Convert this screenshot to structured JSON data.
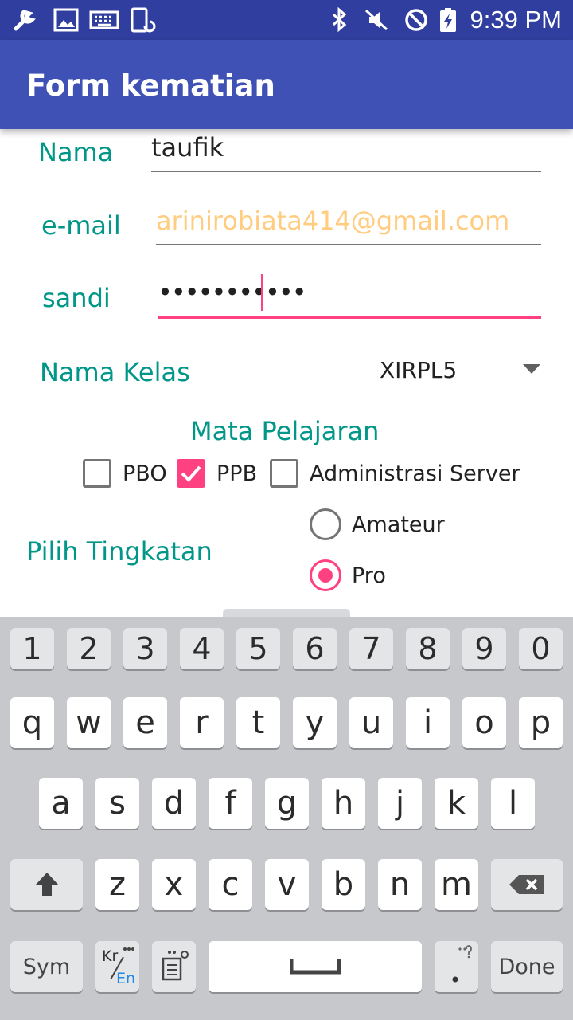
{
  "status_bar": {
    "time": "9:39 PM",
    "icons": [
      "wrench-icon",
      "image-icon",
      "keyboard-icon",
      "phone-sync-icon",
      "bluetooth-icon",
      "mute-icon",
      "do-not-disturb-icon",
      "battery-charging-icon"
    ]
  },
  "app_bar": {
    "title": "Form kematian"
  },
  "form": {
    "nama": {
      "label": "Nama",
      "value": "taufik"
    },
    "email": {
      "label": "e-mail",
      "placeholder": "arinirobiata414@gmail.com"
    },
    "sandi": {
      "label": "sandi",
      "value": "•••••••••••"
    },
    "kelas": {
      "label": "Nama Kelas",
      "selected": "XIRPL5"
    },
    "mata_pelajaran": {
      "heading": "Mata Pelajaran",
      "options": [
        {
          "label": "PBO",
          "checked": false
        },
        {
          "label": "PPB",
          "checked": true
        },
        {
          "label": "Administrasi Server",
          "checked": false
        }
      ]
    },
    "tingkatan": {
      "label": "Pilih Tingkatan",
      "options": [
        {
          "label": "Amateur",
          "selected": false
        },
        {
          "label": "Pro",
          "selected": true
        }
      ]
    }
  },
  "keyboard": {
    "numbers": [
      "1",
      "2",
      "3",
      "4",
      "5",
      "6",
      "7",
      "8",
      "9",
      "0"
    ],
    "row1": [
      "q",
      "w",
      "e",
      "r",
      "t",
      "y",
      "u",
      "i",
      "o",
      "p"
    ],
    "row2": [
      "a",
      "s",
      "d",
      "f",
      "g",
      "h",
      "j",
      "k",
      "l"
    ],
    "row3": [
      "z",
      "x",
      "c",
      "v",
      "b",
      "n",
      "m"
    ],
    "sym_label": "Sym",
    "lang_top": "Kr",
    "lang_bottom": "En",
    "done_label": "Done"
  },
  "colors": {
    "status_bar": "#303f9f",
    "app_bar": "#3f51b5",
    "label_teal": "#009688",
    "accent_pink": "#ff4081",
    "placeholder_orange": "#ffcc80"
  }
}
